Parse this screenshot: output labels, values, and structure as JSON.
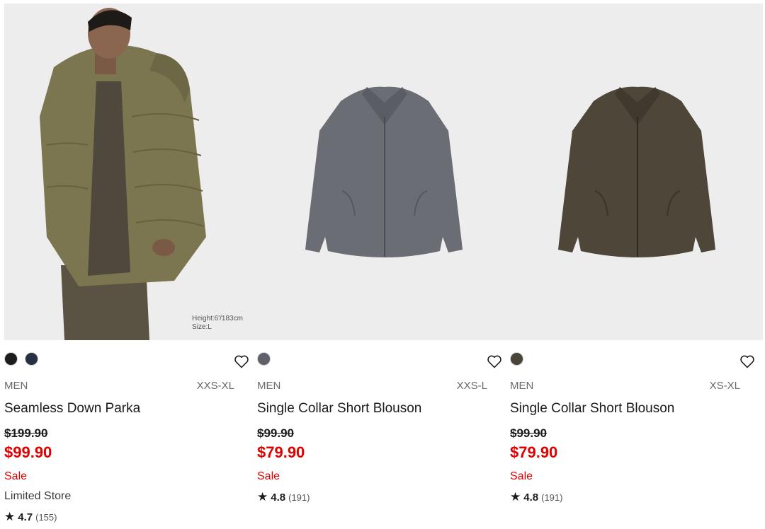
{
  "products": [
    {
      "model_note": [
        "Height:6'/183cm",
        "Size:L"
      ],
      "swatches": [
        "#1d1d1d",
        "#263043"
      ],
      "gender": "MEN",
      "sizes": "XXS-XL",
      "name": "Seamless Down Parka",
      "original_price": "$199.90",
      "sale_price": "$99.90",
      "flag": "Sale",
      "store_note": "Limited Store",
      "rating": "4.7",
      "reviews": "(155)"
    },
    {
      "swatches": [
        "#5e6169"
      ],
      "gender": "MEN",
      "sizes": "XXS-L",
      "name": "Single Collar Short Blouson",
      "original_price": "$99.90",
      "sale_price": "$79.90",
      "flag": "Sale",
      "rating": "4.8",
      "reviews": "(191)"
    },
    {
      "swatches": [
        "#4a4338"
      ],
      "gender": "MEN",
      "sizes": "XS-XL",
      "name": "Single Collar Short Blouson",
      "original_price": "$99.90",
      "sale_price": "$79.90",
      "flag": "Sale",
      "rating": "4.8",
      "reviews": "(191)"
    }
  ],
  "icons": {
    "favorite": "heart-outline-icon",
    "rating": "star-icon"
  },
  "colors": {
    "sale": "#e00000",
    "image_bg": "#ededed"
  }
}
